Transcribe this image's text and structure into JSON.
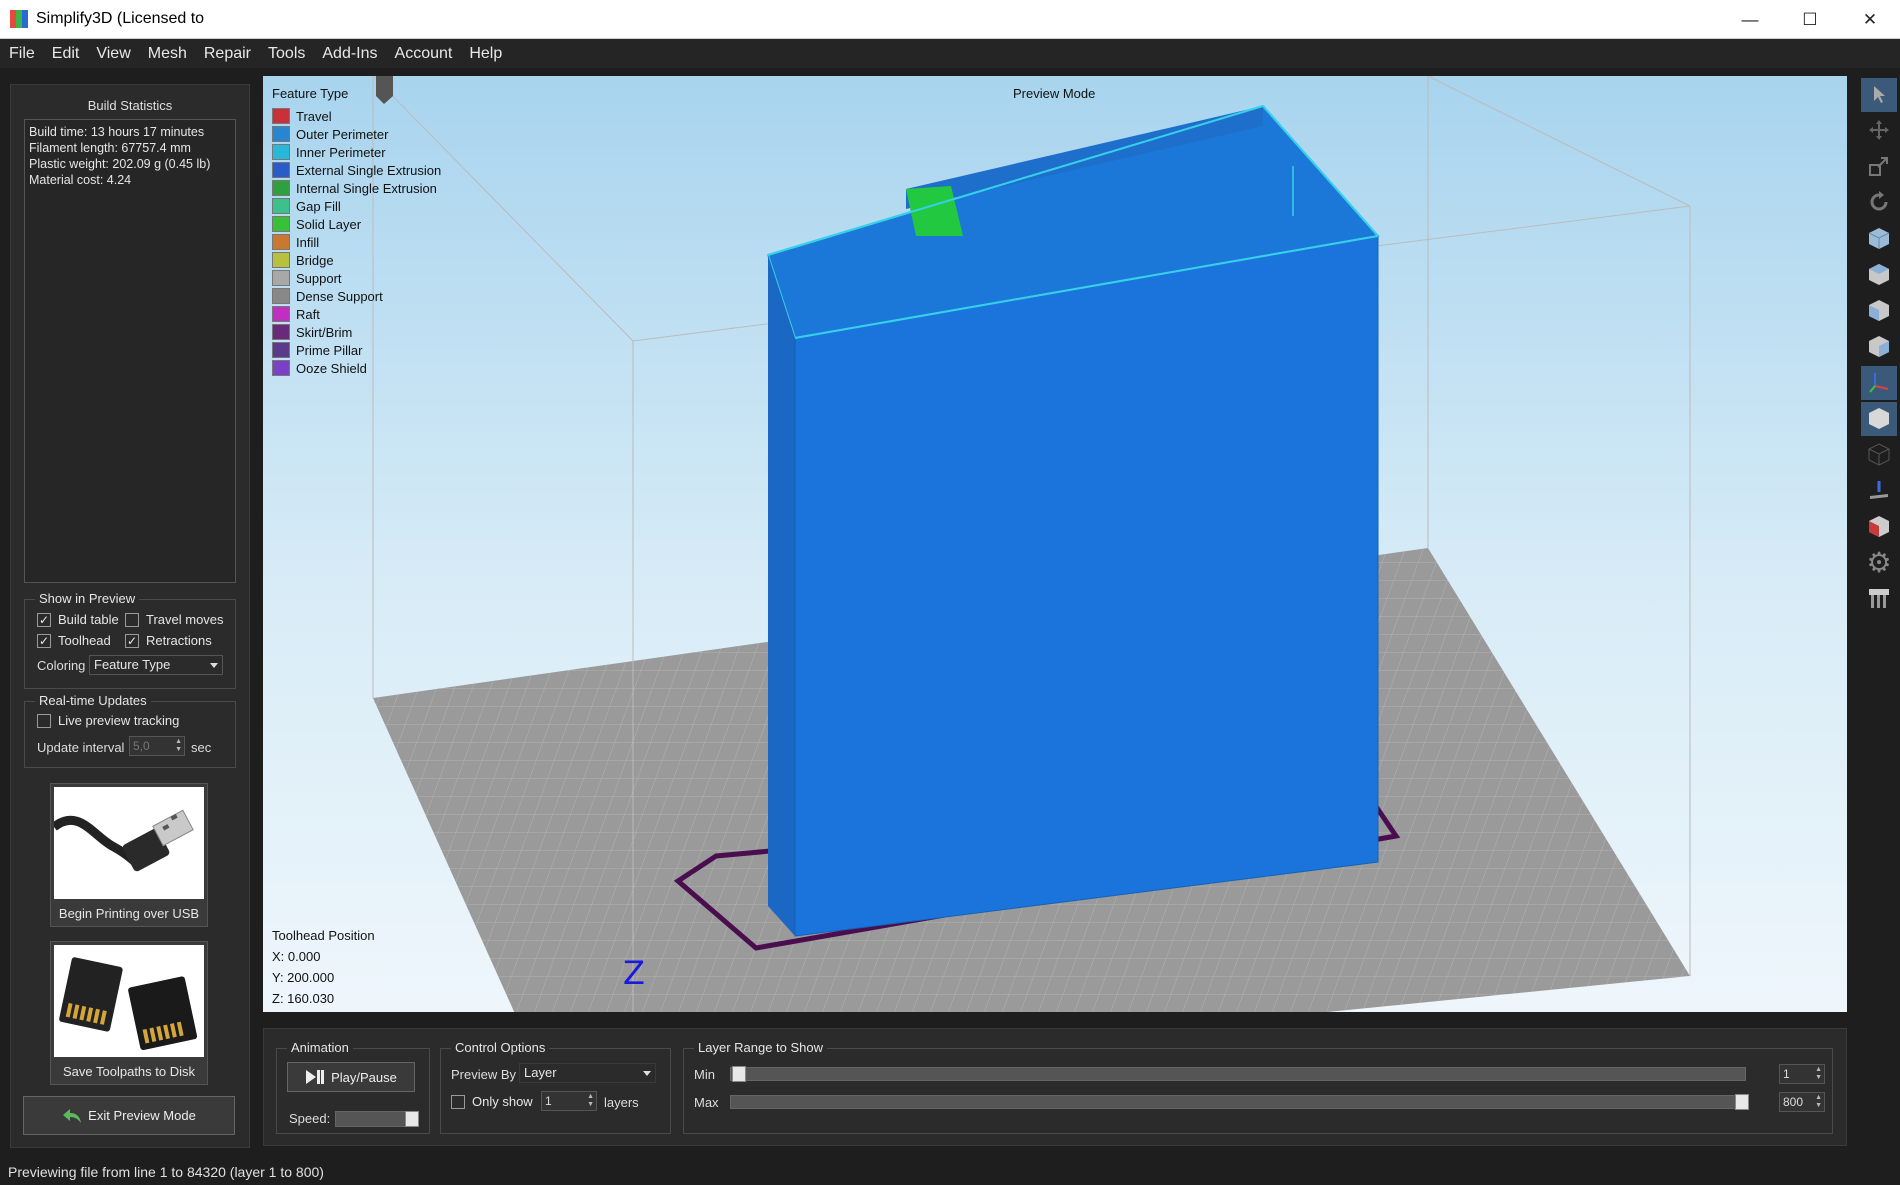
{
  "window": {
    "title": "Simplify3D (Licensed to",
    "minimize": "—",
    "maximize": "☐",
    "close": "✕"
  },
  "menu": [
    "File",
    "Edit",
    "View",
    "Mesh",
    "Repair",
    "Tools",
    "Add-Ins",
    "Account",
    "Help"
  ],
  "left_panel": {
    "title": "Build Statistics",
    "stats": [
      "Build time: 13 hours 17 minutes",
      "Filament length: 67757.4 mm",
      "Plastic weight: 202.09 g (0.45 lb)",
      "Material cost: 4.24"
    ],
    "show_in_preview": {
      "legend": "Show in Preview",
      "build_table": "Build table",
      "build_table_checked": true,
      "travel_moves": "Travel moves",
      "travel_moves_checked": false,
      "toolhead": "Toolhead",
      "toolhead_checked": true,
      "retractions": "Retractions",
      "retractions_checked": true,
      "coloring_label": "Coloring",
      "coloring_value": "Feature Type"
    },
    "realtime": {
      "legend": "Real-time Updates",
      "live_preview": "Live preview tracking",
      "live_preview_checked": false,
      "update_interval_label": "Update interval",
      "update_interval_value": "5,0",
      "update_interval_unit": "sec"
    },
    "usb_button": "Begin Printing over USB",
    "sd_button": "Save Toolpaths to Disk",
    "exit_button": "Exit Preview Mode"
  },
  "viewport": {
    "legend_title": "Feature Type",
    "preview_mode": "Preview Mode",
    "feature_types": [
      {
        "name": "Travel",
        "color": "#c8303a"
      },
      {
        "name": "Outer Perimeter",
        "color": "#2a85d0"
      },
      {
        "name": "Inner Perimeter",
        "color": "#2ab8d8"
      },
      {
        "name": "External Single Extrusion",
        "color": "#2a5cc8"
      },
      {
        "name": "Internal Single Extrusion",
        "color": "#2ea040"
      },
      {
        "name": "Gap Fill",
        "color": "#3cc08c"
      },
      {
        "name": "Solid Layer",
        "color": "#38c038"
      },
      {
        "name": "Infill",
        "color": "#c87830"
      },
      {
        "name": "Bridge",
        "color": "#b8c040"
      },
      {
        "name": "Support",
        "color": "#a8a8a8"
      },
      {
        "name": "Dense Support",
        "color": "#888888"
      },
      {
        "name": "Raft",
        "color": "#c030c0"
      },
      {
        "name": "Skirt/Brim",
        "color": "#6a2a7a"
      },
      {
        "name": "Prime Pillar",
        "color": "#5a3a8a"
      },
      {
        "name": "Ooze Shield",
        "color": "#7a40c8"
      }
    ],
    "toolhead_label": "Toolhead Position",
    "x": "X: 0.000",
    "y": "Y: 200.000",
    "z": "Z: 160.030",
    "axis_z": "Z"
  },
  "bottom_panel": {
    "animation_legend": "Animation",
    "play_pause": "Play/Pause",
    "speed_label": "Speed:",
    "control_legend": "Control Options",
    "preview_by_label": "Preview By",
    "preview_by_value": "Layer",
    "only_show_label": "Only show",
    "only_show_value": "1",
    "layers_label": "layers",
    "layer_range_legend": "Layer Range to Show",
    "min_label": "Min",
    "min_value": "1",
    "max_label": "Max",
    "max_value": "800"
  },
  "status": "Previewing file from line 1 to 84320 (layer 1 to 800)"
}
